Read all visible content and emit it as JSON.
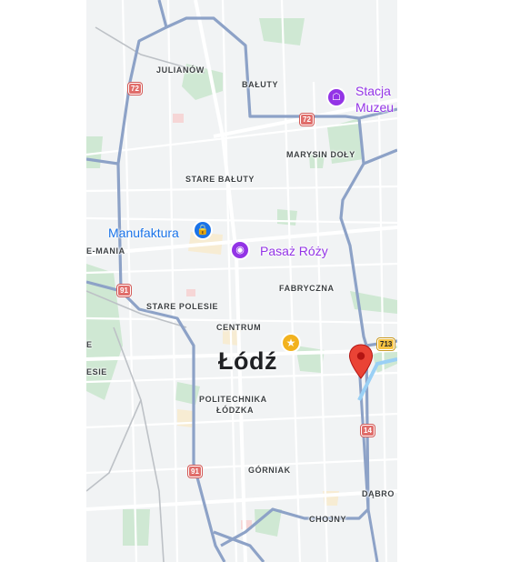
{
  "map": {
    "city_label": "Łódź",
    "districts": [
      "JULIANÓW",
      "BAŁUTY",
      "MARYSIN DOŁY",
      "STARE BAŁUTY",
      "E-MANIA",
      "FABRYCZNA",
      "STARE POLESIE",
      "CENTRUM",
      "E",
      "ESIE",
      "POLITECHNIKA",
      "ŁÓDZKA",
      "GÓRNIAK",
      "DĄBRO",
      "CHOJNY"
    ],
    "pois": {
      "manufaktura": "Manufaktura",
      "pasaz_rozy": "Pasaż Róży",
      "stacja_line1": "Stacja",
      "stacja_line2": "Muzeu"
    },
    "road_shields": [
      "72",
      "72",
      "91",
      "91",
      "14",
      "713"
    ],
    "colors": {
      "poi_blue": "#1a73e8",
      "poi_purple": "#9334e6",
      "ring_road": "#8da2c7",
      "park": "#c8e6c9",
      "marker": "#ea4335"
    }
  }
}
